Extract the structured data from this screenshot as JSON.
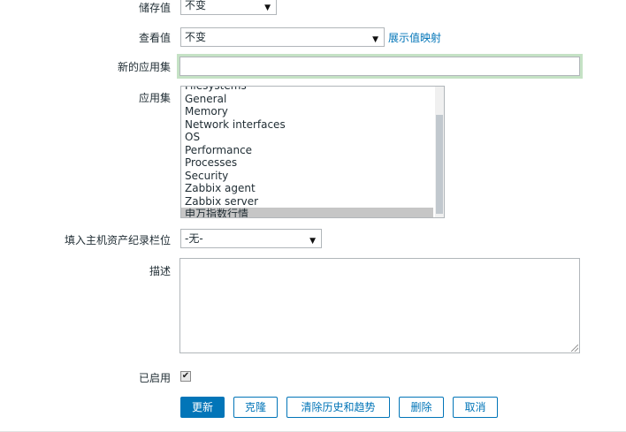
{
  "form": {
    "storage": {
      "label": "储存值",
      "value": "不变"
    },
    "display": {
      "label": "查看值",
      "value": "不变",
      "link": "展示值映射"
    },
    "new_app": {
      "label": "新的应用集",
      "value": ""
    },
    "apps": {
      "label": "应用集",
      "items": [
        "Filesystems",
        "General",
        "Memory",
        "Network interfaces",
        "OS",
        "Performance",
        "Processes",
        "Security",
        "Zabbix agent",
        "Zabbix server",
        "申万指数行情"
      ],
      "selected": "申万指数行情"
    },
    "inventory": {
      "label": "填入主机资产纪录栏位",
      "value": "-无-"
    },
    "description": {
      "label": "描述",
      "value": ""
    },
    "enabled": {
      "label": "已启用",
      "checked": true
    }
  },
  "buttons": {
    "update": "更新",
    "clone": "克隆",
    "clear": "清除历史和趋势",
    "delete": "删除",
    "cancel": "取消"
  },
  "colors": {
    "accent": "#0275b8",
    "focus_border": "#c5e2c5"
  }
}
